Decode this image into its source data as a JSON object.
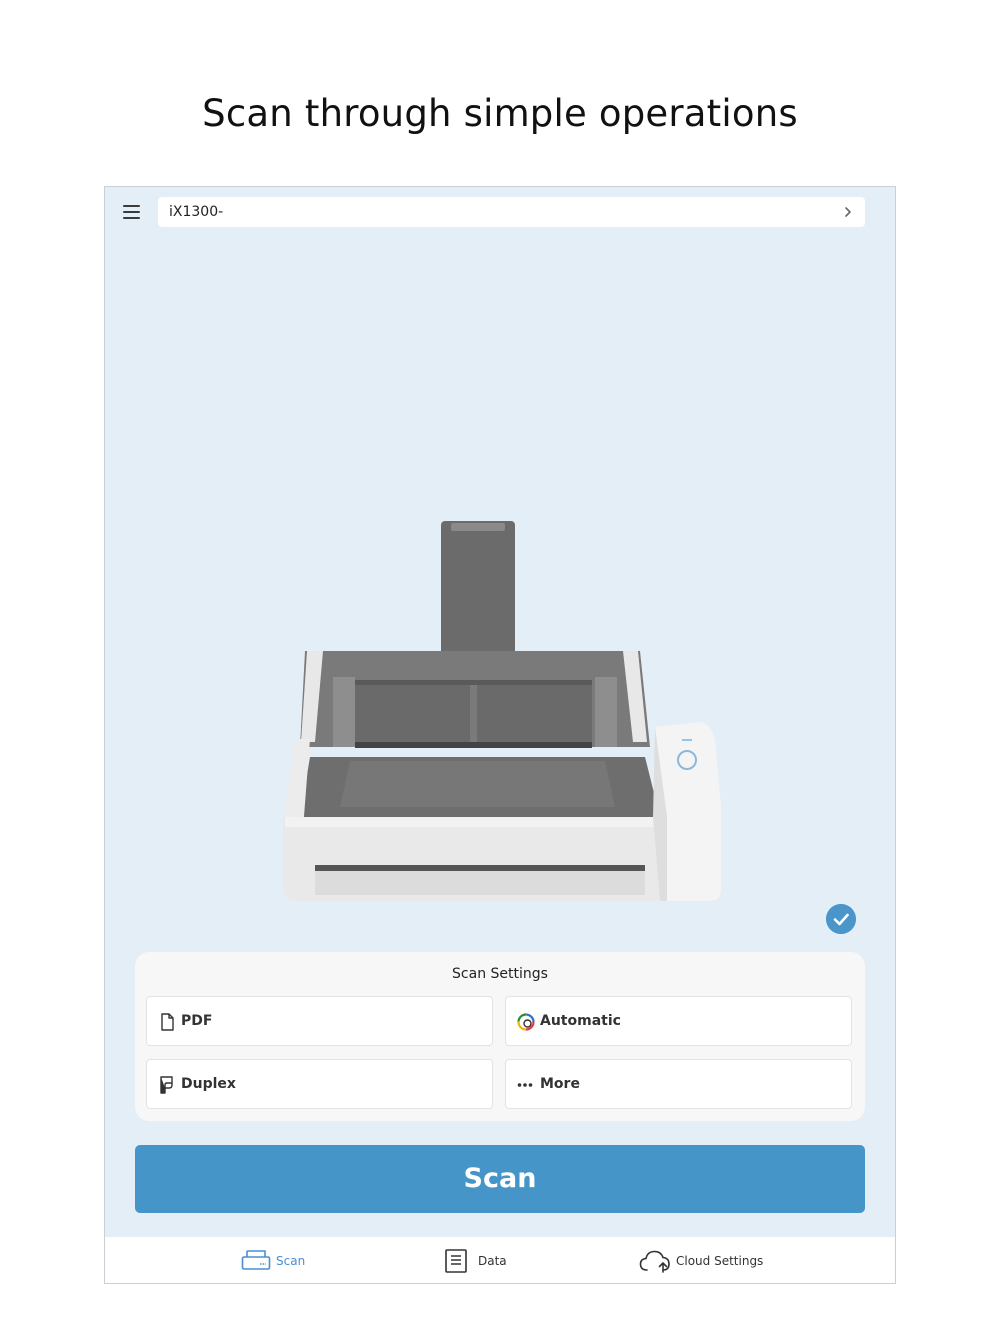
{
  "headline": "Scan through simple operations",
  "top_bar": {
    "device_name": "iX1300-"
  },
  "scan_settings": {
    "title": "Scan Settings",
    "options": [
      {
        "label": "PDF",
        "icon": "document-icon"
      },
      {
        "label": "Automatic",
        "icon": "color-mode-icon"
      },
      {
        "label": "Duplex",
        "icon": "duplex-icon"
      },
      {
        "label": "More",
        "icon": "more-dots-icon"
      }
    ]
  },
  "scan_button": {
    "label": "Scan"
  },
  "tab_bar": {
    "tabs": [
      {
        "label": "Scan",
        "icon": "scanner-icon",
        "active": true
      },
      {
        "label": "Data",
        "icon": "list-document-icon",
        "active": false
      },
      {
        "label": "Cloud Settings",
        "icon": "cloud-upload-icon",
        "active": false
      }
    ]
  },
  "colors": {
    "accent": "#4595C9",
    "background": "#E4EEF7",
    "active_tab": "#4A8ED4"
  }
}
